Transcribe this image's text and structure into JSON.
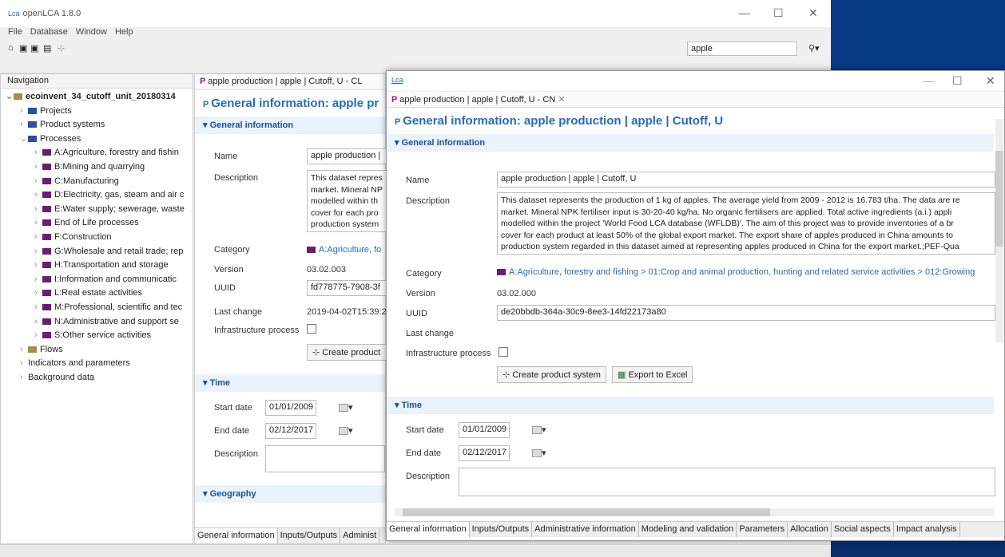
{
  "app": {
    "logo": "Lca",
    "title": "openLCA 1.8.0",
    "menu": [
      "File",
      "Database",
      "Window",
      "Help"
    ],
    "search_value": "apple"
  },
  "nav": {
    "header": "Navigation",
    "items": [
      {
        "label": "ecoinvent_34_cutoff_unit_20180314",
        "level": 0,
        "folder": "y",
        "bold": true
      },
      {
        "label": "Projects",
        "level": 1,
        "folder": "b"
      },
      {
        "label": "Product systems",
        "level": 1,
        "folder": "b"
      },
      {
        "label": "Processes",
        "level": 1,
        "folder": "b"
      },
      {
        "label": "A:Agriculture, forestry and fishin",
        "level": 2,
        "folder": "p"
      },
      {
        "label": "B:Mining and quarrying",
        "level": 2,
        "folder": "p"
      },
      {
        "label": "C:Manufacturing",
        "level": 2,
        "folder": "p"
      },
      {
        "label": "D:Electricity, gas, steam and air c",
        "level": 2,
        "folder": "p"
      },
      {
        "label": "E:Water supply; sewerage, waste",
        "level": 2,
        "folder": "p"
      },
      {
        "label": "End of Life processes",
        "level": 2,
        "folder": "p"
      },
      {
        "label": "F:Construction",
        "level": 2,
        "folder": "p"
      },
      {
        "label": "G:Wholesale and retail trade; rep",
        "level": 2,
        "folder": "p"
      },
      {
        "label": "H:Transportation and storage",
        "level": 2,
        "folder": "p"
      },
      {
        "label": "I:Information and communicatic",
        "level": 2,
        "folder": "p"
      },
      {
        "label": "L:Real estate activities",
        "level": 2,
        "folder": "p"
      },
      {
        "label": "M:Professional, scientific and tec",
        "level": 2,
        "folder": "p"
      },
      {
        "label": "N:Administrative and support se",
        "level": 2,
        "folder": "p"
      },
      {
        "label": "S:Other service activities",
        "level": 2,
        "folder": "p"
      },
      {
        "label": "Flows",
        "level": 1,
        "folder": "y"
      },
      {
        "label": "Indicators and parameters",
        "level": 1,
        "folder": "none"
      },
      {
        "label": "Background data",
        "level": 1,
        "folder": "none"
      }
    ]
  },
  "back": {
    "tab": "apple production | apple | Cutoff, U - CL",
    "heading": "General information: apple pr",
    "section": "General information",
    "name_label": "Name",
    "name_value": "apple production |",
    "desc_label": "Description",
    "desc_lines": [
      "This dataset repres",
      "market. Mineral NP",
      "modelled within th",
      "cover for each pro",
      "production system"
    ],
    "category_label": "Category",
    "category_value": "A:Agriculture, fo",
    "version_label": "Version",
    "version_value": "03.02.003",
    "uuid_label": "UUID",
    "uuid_value": "fd778775-7908-3f",
    "lastchange_label": "Last change",
    "lastchange_value": "2019-04-02T15:39:2",
    "infra_label": "Infrastructure process",
    "create_btn": "Create product",
    "time_section": "Time",
    "start_label": "Start date",
    "start_value": "01/01/2009",
    "end_label": "End date",
    "end_value": "02/12/2017",
    "tdesc_label": "Description",
    "geo_section": "Geography",
    "bottom_tabs": [
      "General information",
      "Inputs/Outputs",
      "Administ"
    ]
  },
  "front": {
    "logo": "Lca",
    "tab": "apple production | apple | Cutoff, U - CN",
    "heading": "General information: apple production | apple | Cutoff, U",
    "section": "General information",
    "name_label": "Name",
    "name_value": "apple production | apple | Cutoff, U",
    "desc_label": "Description",
    "desc_lines": [
      "This dataset represents the production of 1 kg of apples. The average yield from 2009 - 2012 is 16.783 t/ha. The data are re",
      "market. Mineral NPK fertiliser input is 30-20-40 kg/ha. No organic fertilisers are applied. Total active ingredients (a.i.) appli",
      "modelled within the project 'World Food LCA database (WFLDB)'. The aim of this project was to provide inventories of a br",
      "cover for each product at least 50% of the global export market. The export share of apples produced in China amounts to",
      "production system regarded in this dataset aimed at representing apples produced in China for the export market.;PEF-Qua"
    ],
    "category_label": "Category",
    "category_value": "A:Agriculture, forestry and fishing  > 01:Crop and animal production, hunting and related service activities > 012:Growing",
    "version_label": "Version",
    "version_value": "03.02.000",
    "uuid_label": "UUID",
    "uuid_value": "de20bbdb-364a-30c9-8ee3-14fd22173a80",
    "lastchange_label": "Last change",
    "infra_label": "Infrastructure process",
    "create_btn": "Create product system",
    "excel_btn": "Export to Excel",
    "time_section": "Time",
    "start_label": "Start date",
    "start_value": "01/01/2009",
    "end_label": "End date",
    "end_value": "02/12/2017",
    "tdesc_label": "Description",
    "bottom_tabs": [
      "General information",
      "Inputs/Outputs",
      "Administrative information",
      "Modeling and validation",
      "Parameters",
      "Allocation",
      "Social aspects",
      "Impact analysis"
    ]
  }
}
